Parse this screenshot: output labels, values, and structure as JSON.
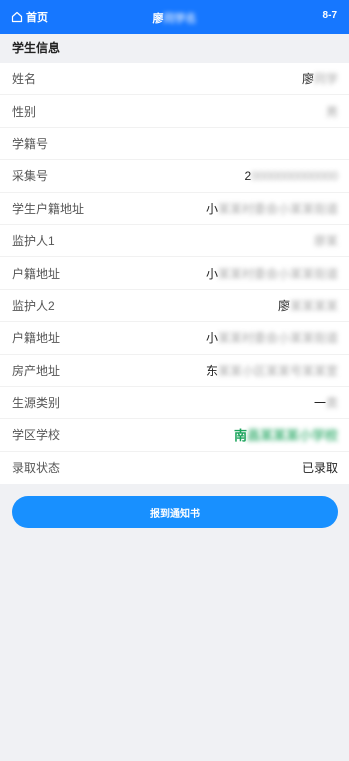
{
  "header": {
    "home_label": "首页",
    "title_visible": "廖",
    "title_hidden": "同学名",
    "page_indicator": "8-7"
  },
  "section_title": "学生信息",
  "fields": [
    {
      "label": "姓名",
      "value_visible": "廖",
      "value_hidden": "同学"
    },
    {
      "label": "性别",
      "value_visible": "",
      "value_hidden": "男"
    },
    {
      "label": "学籍号",
      "value_visible": "",
      "value_hidden": ""
    },
    {
      "label": "采集号",
      "value_visible": "2",
      "value_hidden": "0000000000000"
    },
    {
      "label": "学生户籍地址",
      "value_visible": "小",
      "value_hidden": "某某村委会小某某街道"
    },
    {
      "label": "监护人1",
      "value_visible": "",
      "value_hidden": "廖某"
    },
    {
      "label": "户籍地址",
      "value_visible": "小",
      "value_hidden": "某某村委会小某某街道"
    },
    {
      "label": "监护人2",
      "value_visible": "廖",
      "value_hidden": "某某某某"
    },
    {
      "label": "户籍地址",
      "value_visible": "小",
      "value_hidden": "某某村委会小某某街道"
    },
    {
      "label": "房产地址",
      "value_visible": "东",
      "value_hidden": "某某小区某某号某某室"
    },
    {
      "label": "生源类别",
      "value_visible": "一",
      "value_hidden": "类"
    },
    {
      "label": "学区学校",
      "value_visible": "南",
      "value_hidden": "昌某某某小学校"
    },
    {
      "label": "录取状态",
      "value_visible": "已录取",
      "value_hidden": ""
    }
  ],
  "button_label": "报到通知书"
}
